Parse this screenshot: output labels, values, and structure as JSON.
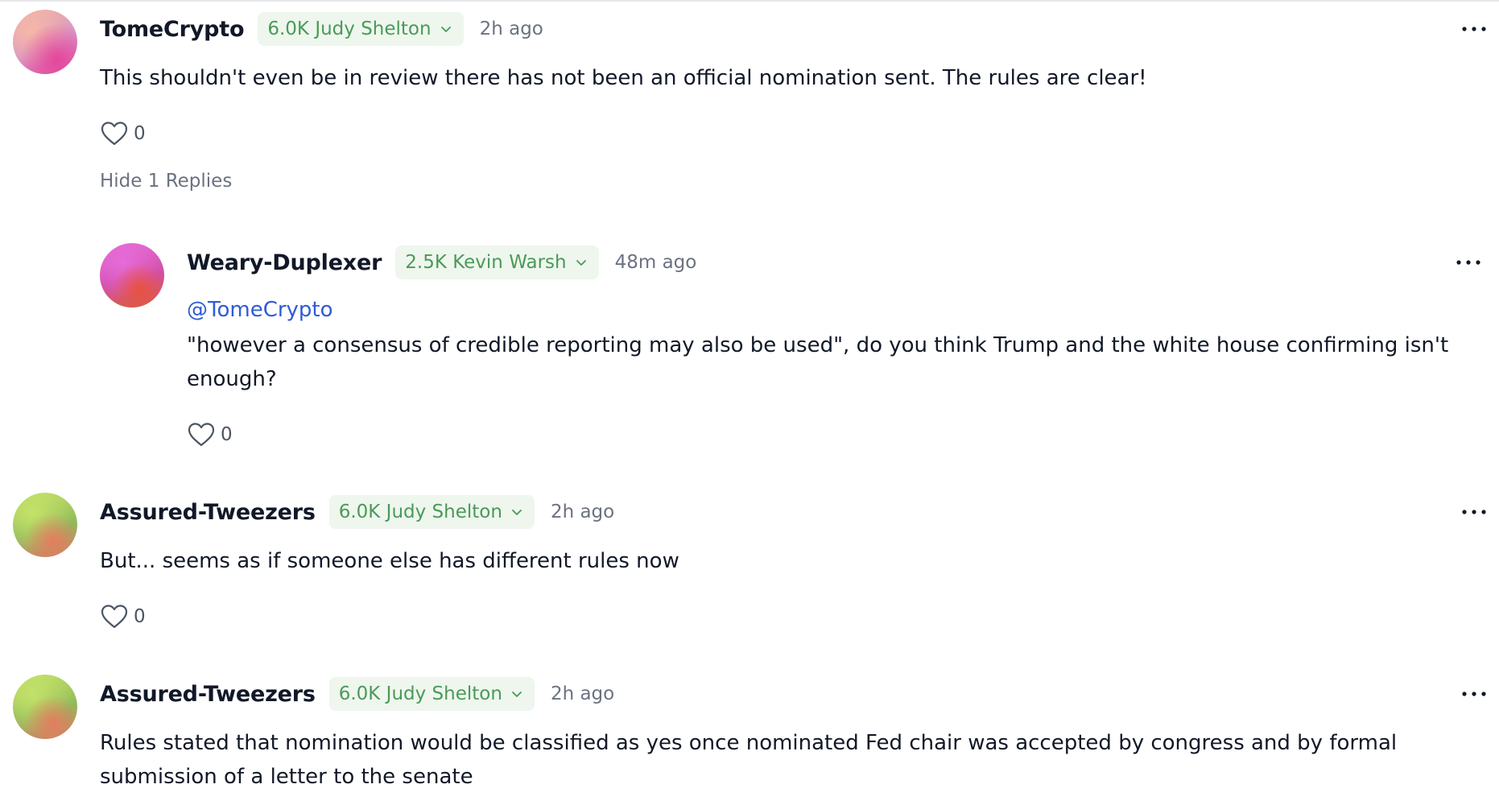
{
  "comments": [
    {
      "username": "TomeCrypto",
      "badge": "6.0K Judy Shelton",
      "time": "2h ago",
      "text": "This shouldn't even be in review there has not been an official nomination sent. The rules are clear!",
      "likes": "0",
      "replies_toggle": "Hide 1 Replies",
      "avatar_colors": [
        "#f3b5a5",
        "#e05aa6"
      ]
    },
    {
      "username": "Weary-Duplexer",
      "badge": "2.5K Kevin Warsh",
      "time": "48m ago",
      "mention": "@TomeCrypto",
      "text_line1": "\"however a consensus of credible reporting may also be used\", do you think Trump and the white house confirming isn't",
      "text_line2": "enough?",
      "likes": "0",
      "avatar_colors": [
        "#e46dd6",
        "#e8523f"
      ]
    },
    {
      "username": "Assured-Tweezers",
      "badge": "6.0K Judy Shelton",
      "time": "2h ago",
      "text": "But... seems as if someone else has different rules now",
      "likes": "0",
      "avatar_colors": [
        "#c0de63",
        "#e57c5f"
      ]
    },
    {
      "username": "Assured-Tweezers",
      "badge": "6.0K Judy Shelton",
      "time": "2h ago",
      "text_line1": "Rules stated that nomination would be classified as yes once nominated Fed chair was accepted by congress and by formal",
      "text_line2": "submission of a letter to the senate",
      "avatar_colors": [
        "#c0de63",
        "#e57c5f"
      ]
    }
  ],
  "icons": {
    "more": "more-horizontal-icon",
    "like": "heart-outline-icon",
    "badge_chevron": "chevron-down-icon"
  },
  "colors": {
    "badge_bg": "#eef6ee",
    "badge_text": "#4a9a58",
    "mention": "#2f5bd6",
    "muted": "#6b7280"
  }
}
